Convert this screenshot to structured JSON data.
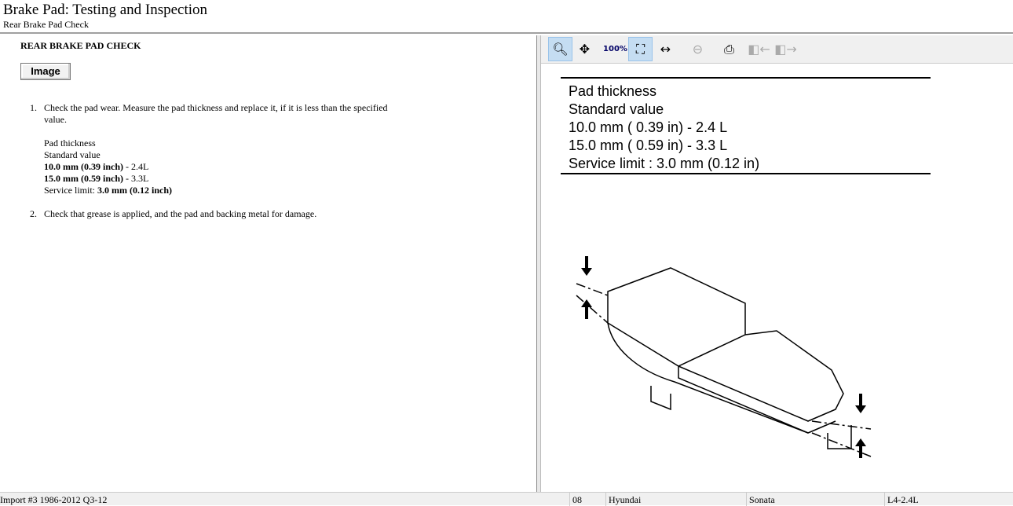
{
  "header": {
    "title": "Brake Pad:  Testing and Inspection",
    "subtitle": "Rear Brake Pad Check"
  },
  "content": {
    "section_title": "REAR BRAKE PAD CHECK",
    "image_button": "Image",
    "steps": [
      {
        "num": "1.",
        "text": "Check the pad wear. Measure the pad thickness and replace it, if it is less than the specified value.",
        "spec_label": "Pad thickness",
        "spec_std": "Standard value",
        "spec1_bold": "10.0 mm (0.39 inch)",
        "spec1_rest": " - 2.4L",
        "spec2_bold": "15.0 mm (0.59 inch)",
        "spec2_rest": " - 3.3L",
        "limit_label": "Service limit: ",
        "limit_bold": "3.0 mm (0.12 inch)"
      },
      {
        "num": "2.",
        "text": "Check that grease is applied, and the pad and backing metal for damage."
      }
    ]
  },
  "toolbar": {
    "buttons": [
      "zoom-in",
      "pan",
      "zoom-100",
      "zoom-fit",
      "zoom-width",
      "zoom-out",
      "print",
      "prev-image",
      "next-image"
    ],
    "zoom_100_label": "100%"
  },
  "diagram": {
    "lines": [
      "Pad thickness",
      "Standard value",
      "10.0 mm ( 0.39 in) - 2.4 L",
      "15.0 mm ( 0.59 in) - 3.3 L",
      "Service limit :  3.0 mm (0.12 in)"
    ]
  },
  "status": {
    "database": "Import #3 1986-2012 Q3-12",
    "year": "08",
    "make": "Hyundai",
    "model": "Sonata",
    "engine": "L4-2.4L"
  }
}
